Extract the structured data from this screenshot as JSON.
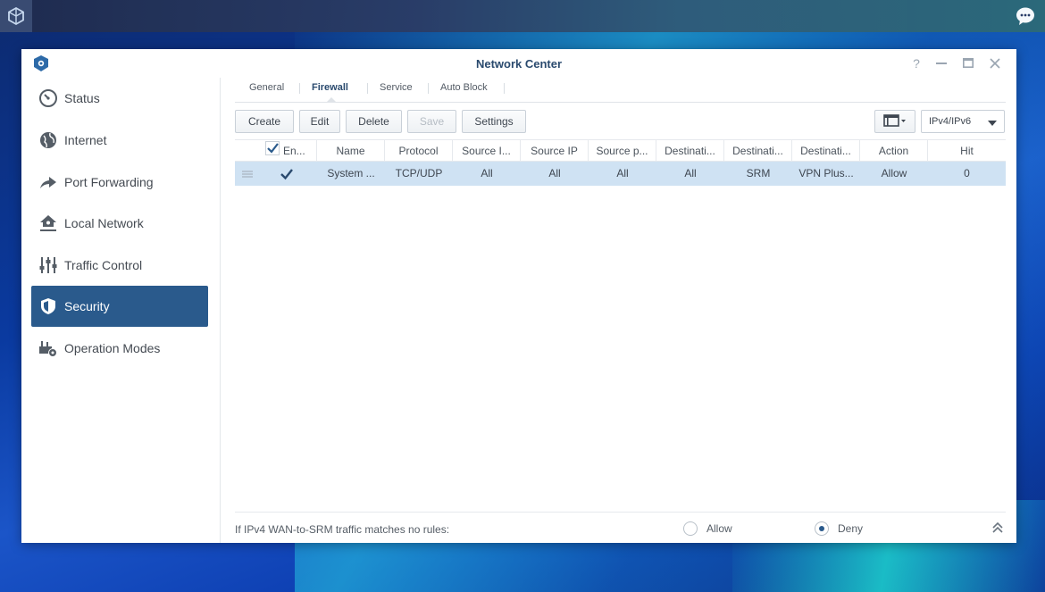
{
  "window": {
    "title": "Network Center",
    "controls": [
      "help",
      "minimize",
      "maximize",
      "close"
    ]
  },
  "sidebar": {
    "items": [
      {
        "label": "Status",
        "icon": "gauge-icon",
        "active": false
      },
      {
        "label": "Internet",
        "icon": "globe-icon",
        "active": false
      },
      {
        "label": "Port Forwarding",
        "icon": "forward-arrow-icon",
        "active": false
      },
      {
        "label": "Local Network",
        "icon": "home-network-icon",
        "active": false
      },
      {
        "label": "Traffic Control",
        "icon": "sliders-icon",
        "active": false
      },
      {
        "label": "Security",
        "icon": "shield-icon",
        "active": true
      },
      {
        "label": "Operation Modes",
        "icon": "router-gear-icon",
        "active": false
      }
    ]
  },
  "tabs": [
    {
      "label": "General",
      "active": false
    },
    {
      "label": "Firewall",
      "active": true
    },
    {
      "label": "Service",
      "active": false
    },
    {
      "label": "Auto Block",
      "active": false
    }
  ],
  "toolbar": {
    "create": "Create",
    "edit": "Edit",
    "delete": "Delete",
    "save": "Save",
    "settings": "Settings",
    "ip_version": "IPv4/IPv6"
  },
  "table": {
    "headers": [
      "En...",
      "Name",
      "Protocol",
      "Source I...",
      "Source IP",
      "Source p...",
      "Destinati...",
      "Destinati...",
      "Destinati...",
      "Action",
      "Hit"
    ],
    "rows": [
      {
        "enabled": true,
        "cells": [
          "System ...",
          "TCP/UDP",
          "All",
          "All",
          "All",
          "All",
          "SRM",
          "VPN Plus...",
          "Allow",
          "0"
        ]
      }
    ]
  },
  "footer": {
    "label": "If IPv4 WAN-to-SRM traffic matches no rules:",
    "allow": "Allow",
    "deny": "Deny",
    "selected": "Deny"
  },
  "colors": {
    "accent": "#2a5a8c",
    "selected_row": "#cfe2f3",
    "title": "#2a4a6e"
  }
}
